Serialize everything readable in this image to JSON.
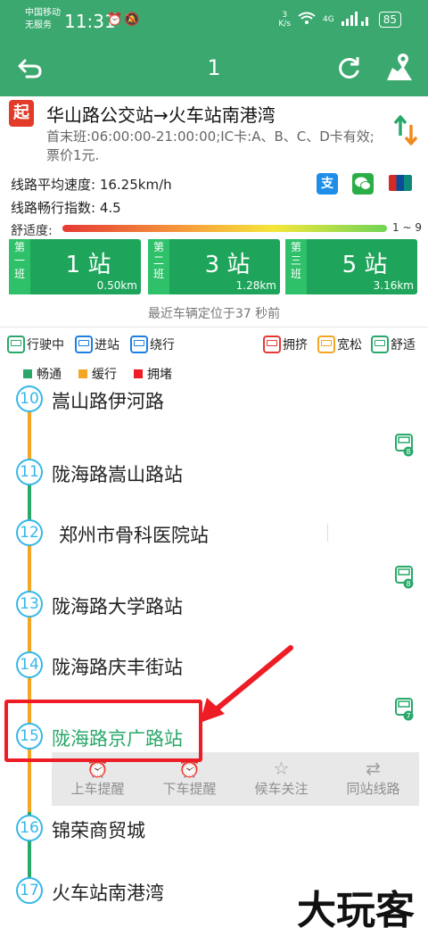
{
  "status_bar": {
    "carrier_line1": "中国移动",
    "carrier_line2": "无服务",
    "time": "11:31",
    "net_speed_value": "3",
    "net_speed_unit": "K/s",
    "network": "4G",
    "battery": "85"
  },
  "toolbar": {
    "title": "1"
  },
  "route": {
    "start_badge": "起",
    "title": "华山路公交站→火车站南港湾",
    "info": "首末班:06:00:00-21:00:00;IC卡:A、B、C、D卡有效;票价1元.",
    "speed": "线路平均速度: 16.25km/h",
    "index": "线路畅行指数: 4.5",
    "comfort_label": "舒适度:",
    "comfort_range": "1 ~ 9",
    "comfort_colors": [
      "#e53935",
      "#f7a23b",
      "#f5e73a",
      "#6fd457"
    ],
    "pay_icons": [
      "alipay-icon",
      "wechat-icon",
      "unionpay-icon"
    ],
    "alipay_glyph": "支"
  },
  "buses": [
    {
      "order": [
        "第",
        "一",
        "班"
      ],
      "stops": "1 站",
      "dist": "0.50km"
    },
    {
      "order": [
        "第",
        "二",
        "班"
      ],
      "stops": "3 站",
      "dist": "1.28km"
    },
    {
      "order": [
        "第",
        "三",
        "班"
      ],
      "stops": "5 站",
      "dist": "3.16km"
    }
  ],
  "recent_locate": "最近车辆定位于37 秒前",
  "legend": {
    "driving": "行驶中",
    "entering": "进站",
    "detour": "绕行",
    "crowded": "拥挤",
    "loose": "宽松",
    "comfortable": "舒适",
    "smooth": "畅通",
    "slow": "缓行",
    "jam": "拥堵",
    "colors": {
      "smooth": "#29a86a",
      "slow": "#f2a623",
      "jam": "#ee1c24",
      "driving": "#29a86a",
      "entering": "#1e7fe0",
      "crowded": "#e53935",
      "loose": "#f2a623"
    }
  },
  "stations": [
    {
      "num": "10",
      "name": "嵩山路伊河路"
    },
    {
      "num": "11",
      "name": "陇海路嵩山路站"
    },
    {
      "num": "12",
      "name": "郑州市骨科医院站"
    },
    {
      "num": "13",
      "name": "陇海路大学路站"
    },
    {
      "num": "14",
      "name": "陇海路庆丰街站"
    },
    {
      "num": "15",
      "name": "陇海路京广路站"
    },
    {
      "num": "16",
      "name": "锦荣商贸城"
    },
    {
      "num": "17",
      "name": "火车站南港湾"
    }
  ],
  "bus_markers": [
    "8",
    "8",
    "7"
  ],
  "actions": [
    {
      "label": "上车提醒",
      "icon": "alarm-clock-icon"
    },
    {
      "label": "下车提醒",
      "icon": "alarm-clock-icon"
    },
    {
      "label": "候车关注",
      "icon": "star-icon"
    },
    {
      "label": "同站线路",
      "icon": "swap-arrows-icon"
    }
  ],
  "watermark": "大玩客"
}
